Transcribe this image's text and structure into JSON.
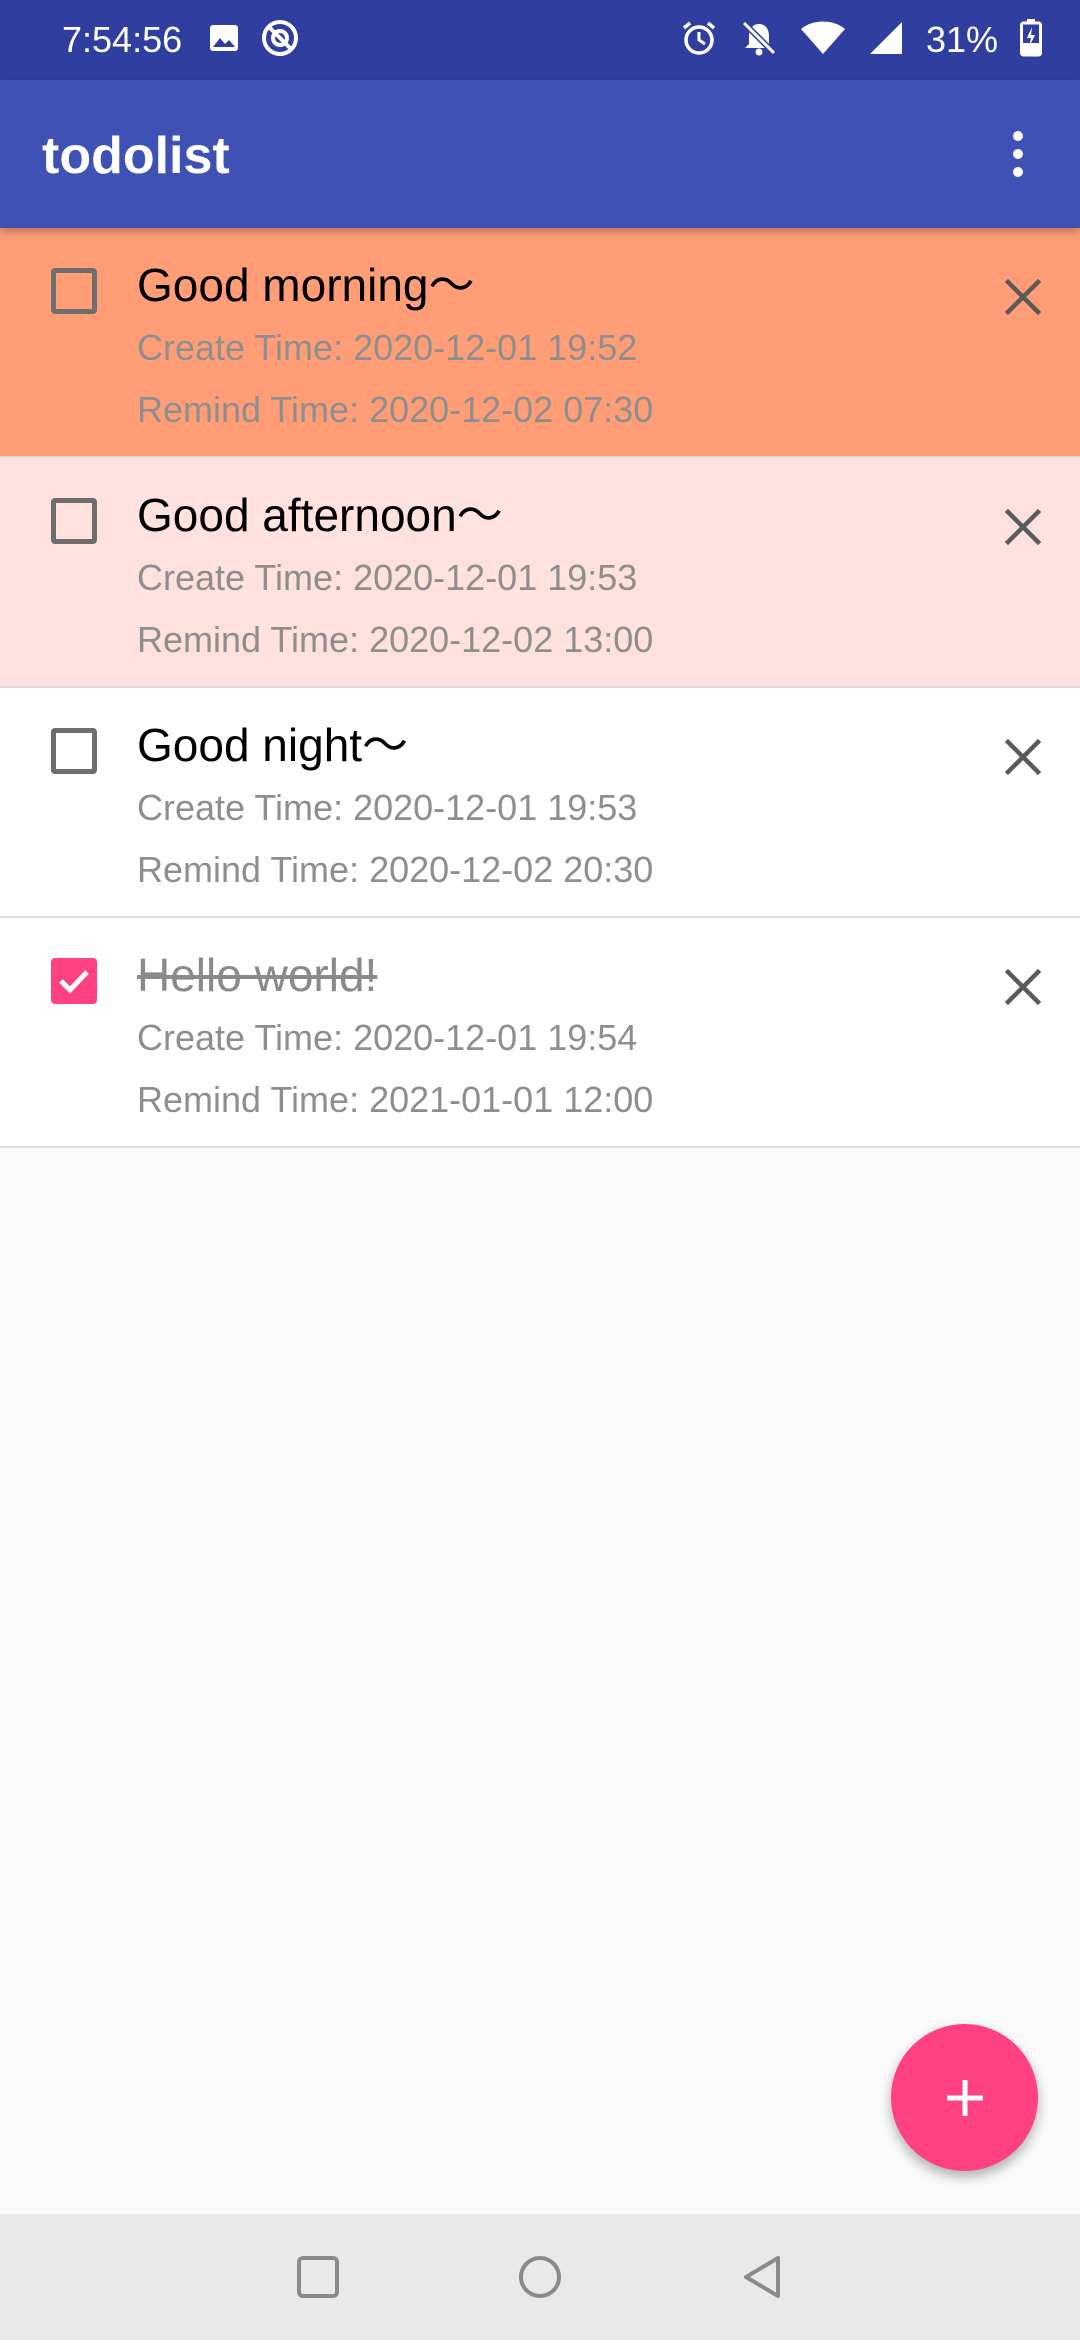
{
  "status_bar": {
    "time": "7:54:56",
    "battery_percent": "31%",
    "icons": [
      "image-icon",
      "sync-icon",
      "alarm-icon",
      "notifications-off-icon",
      "wifi-icon",
      "cellular-signal-icon",
      "battery-charging-icon"
    ]
  },
  "app_bar": {
    "title": "todolist",
    "menu_icon": "more-vert-icon"
  },
  "todos": [
    {
      "title": "Good morning〜",
      "create_time": "Create Time: 2020-12-01 19:52",
      "remind_time": "Remind Time: 2020-12-02 07:30",
      "checked": false,
      "background": "#ff9e76"
    },
    {
      "title": "Good afternoon〜",
      "create_time": "Create Time: 2020-12-01 19:53",
      "remind_time": "Remind Time: 2020-12-02 13:00",
      "checked": false,
      "background": "#ffe1de"
    },
    {
      "title": "Good night〜",
      "create_time": "Create Time: 2020-12-01 19:53",
      "remind_time": "Remind Time: 2020-12-02 20:30",
      "checked": false,
      "background": "#ffffff"
    },
    {
      "title": "Hello world!",
      "create_time": "Create Time: 2020-12-01 19:54",
      "remind_time": "Remind Time: 2021-01-01 12:00",
      "checked": true,
      "background": "#ffffff"
    }
  ],
  "fab": {
    "icon": "add-icon",
    "color": "#ff4081"
  },
  "nav_bar": {
    "buttons": [
      "recents-square-icon",
      "home-circle-icon",
      "back-triangle-icon"
    ]
  },
  "colors": {
    "primary": "#3f51b5",
    "primary_dark": "#303f9f",
    "accent": "#ff4081"
  }
}
